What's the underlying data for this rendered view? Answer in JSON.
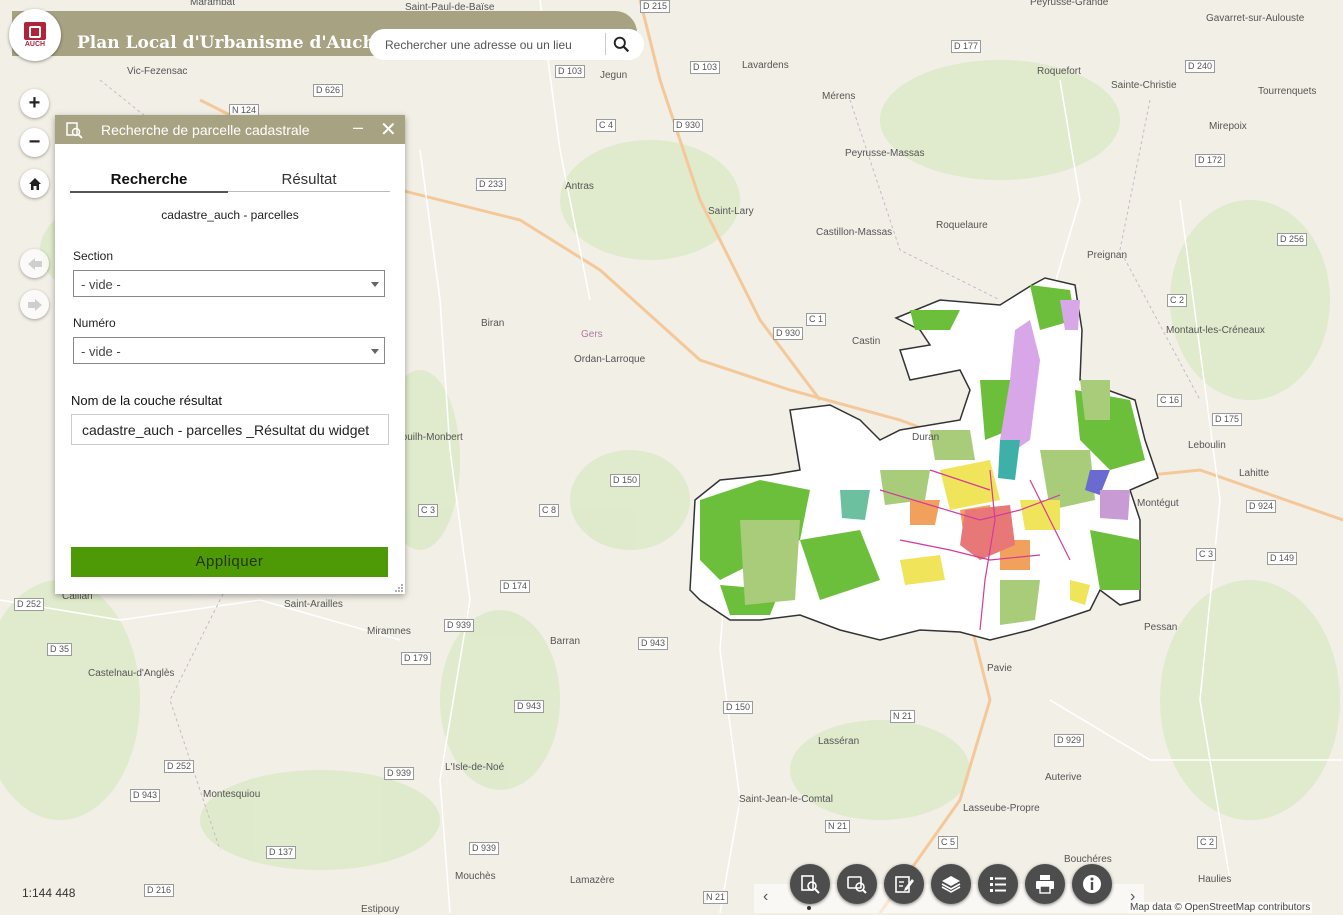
{
  "header": {
    "title": "Plan Local d'Urbanisme d'Auch",
    "logo_text": "AUCH",
    "search_placeholder": "Rechercher une adresse ou un lieu"
  },
  "colors": {
    "header": "#a7a282",
    "apply": "#4e9a06",
    "tool": "#4d4d4d"
  },
  "map_controls": [
    "zoom-in-icon",
    "zoom-out-icon",
    "home-icon",
    "previous-extent-icon",
    "next-extent-icon"
  ],
  "panel": {
    "title": "Recherche de parcelle cadastrale",
    "tabs": [
      "Recherche",
      "Résultat"
    ],
    "layer_name": "cadastre_auch - parcelles",
    "section_label": "Section",
    "section_value": "- vide -",
    "numero_label": "Numéro",
    "numero_value": "- vide -",
    "result_label": "Nom de la couche résultat",
    "result_value": "cadastre_auch - parcelles _Résultat du widget",
    "apply_label": "Appliquer"
  },
  "map": {
    "places": [
      "Marambat",
      "Saint-Paul-de-Baïse",
      "Vic-Fezensac",
      "Jegun",
      "Lavardens",
      "Roquefort",
      "Sainte-Christie",
      "Gavarret-sur-Aulouste",
      "Tourrenquets",
      "Mérens",
      "Mirepoix",
      "Peyrusse-Massas",
      "Antras",
      "Saint-Lary",
      "Roquelaure",
      "Castillon-Massas",
      "Preignan",
      "Biran",
      "Castin",
      "Montaut-les-Créneaux",
      "Gers",
      "Ordan-Larroque",
      "Duran",
      "Leboulin",
      "Lahitte",
      "Montégut",
      "Callian",
      "Saint-Arailles",
      "Miramnes",
      "Barran",
      "Pessan",
      "Castelnau-d'Anglès",
      "Pavie",
      "Lasséran",
      "Auterive",
      "L'Isle-de-Noé",
      "Montesquiou",
      "Saint-Jean-le-Comtal",
      "Lasseube-Propre",
      "Bouchéres",
      "Mouchès",
      "Lamazère",
      "Haulies",
      "Estipouy",
      "Peyrusse-Grande",
      "Bouilh-Monbert"
    ],
    "roads": [
      "D 215",
      "D 177",
      "D 240",
      "N 124",
      "D 103",
      "D 103",
      "C 4",
      "D 930",
      "D 172",
      "D 233",
      "D 256",
      "C 1",
      "D 930",
      "C 2",
      "C 16",
      "D 175",
      "D 150",
      "C 3",
      "C 8",
      "D 924",
      "D 174",
      "D 939",
      "D 943",
      "D 179",
      "D 252",
      "D 35",
      "C 3",
      "D 149",
      "D 150",
      "N 21",
      "D 929",
      "D 943",
      "D 252",
      "D 943",
      "D 137",
      "D 939",
      "D 216",
      "N 21",
      "C 5",
      "C 2",
      "N 21",
      "D 939",
      "D 626"
    ],
    "scale": "1:144 448",
    "attribution": "Map data © OpenStreetMap contributors"
  },
  "toolbar": {
    "tools": [
      "parcel-search-icon",
      "query-icon",
      "edit-icon",
      "layers-icon",
      "legend-icon",
      "print-icon",
      "info-icon"
    ]
  }
}
